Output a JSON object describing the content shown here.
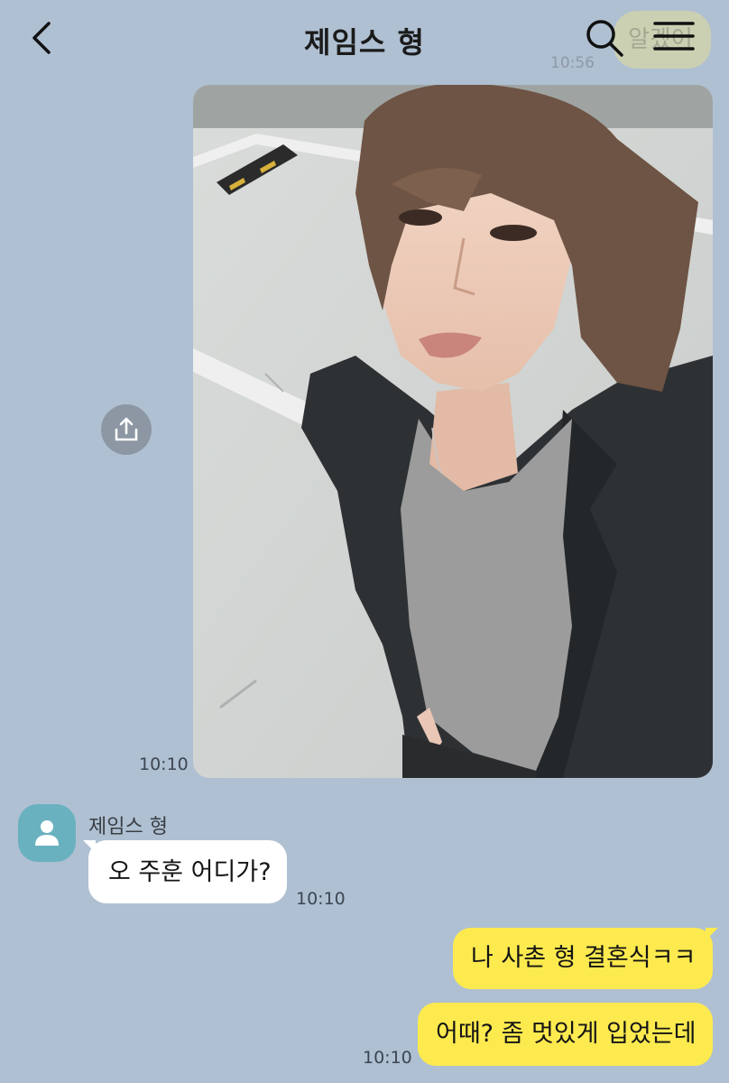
{
  "header": {
    "title": "제임스 형",
    "ghost_message": "알겠어",
    "ghost_time": "10:56"
  },
  "messages": [
    {
      "type": "photo",
      "from": "me",
      "time": "10:10"
    },
    {
      "type": "text",
      "from": "them",
      "sender": "제임스 형",
      "text": "오 주훈 어디가?",
      "time": "10:10"
    },
    {
      "type": "text",
      "from": "me",
      "text": "나 사촌 형 결혼식ㅋㅋ"
    },
    {
      "type": "text",
      "from": "me",
      "text": "어때? 좀 멋있게 입었는데",
      "time": "10:10"
    }
  ],
  "icons": {
    "back": "chevron-left-icon",
    "search": "search-icon",
    "menu": "hamburger-menu-icon",
    "share": "share-upload-icon",
    "avatar": "person-icon"
  },
  "colors": {
    "background": "#afc0d2",
    "my_bubble": "#fdea4f",
    "their_bubble": "#ffffff",
    "avatar": "#6ab1c0",
    "share_button": "#8c97a3"
  }
}
